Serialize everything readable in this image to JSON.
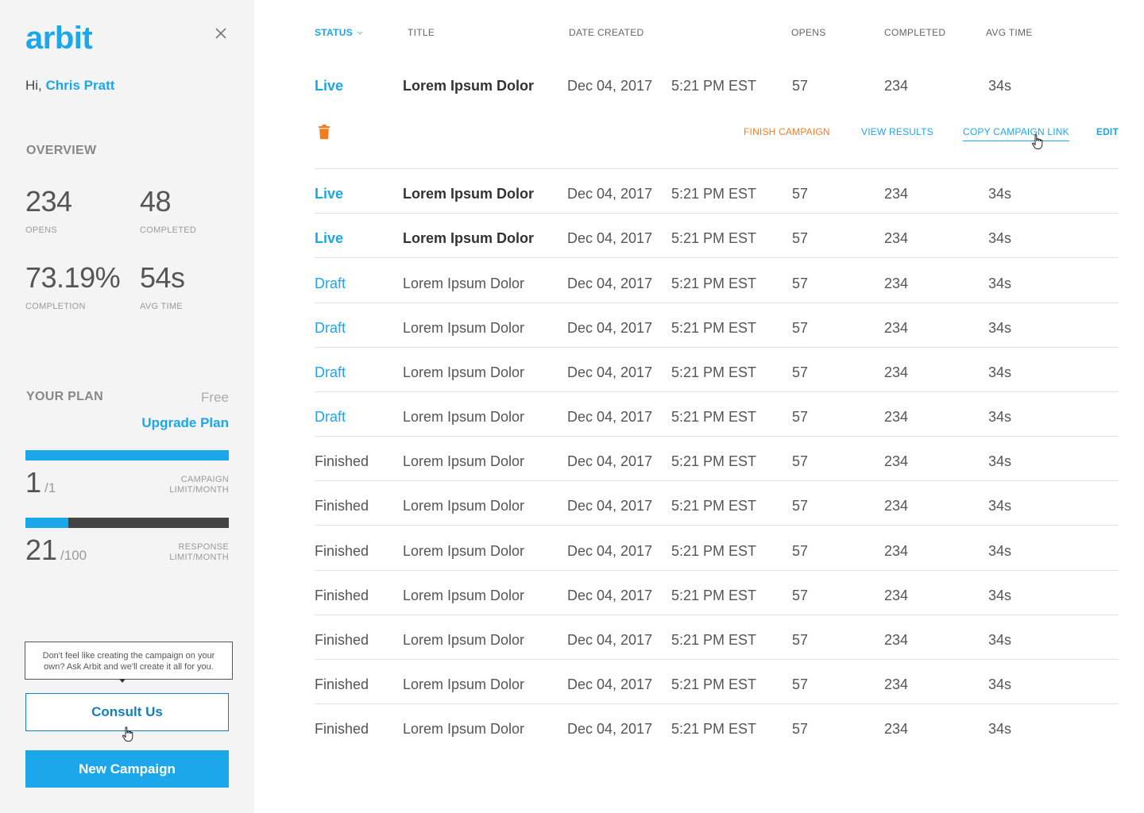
{
  "sidebar": {
    "logo": "arbit",
    "greeting_prefix": "Hi, ",
    "user_name": "Chris Pratt",
    "overview_title": "OVERVIEW",
    "stats": [
      {
        "value": "234",
        "label": "OPENS"
      },
      {
        "value": "48",
        "label": "COMPLETED"
      },
      {
        "value": "73.19%",
        "label": "COMPLETION"
      },
      {
        "value": "54s",
        "label": "AVG TIME"
      }
    ],
    "plan": {
      "title": "YOUR PLAN",
      "name": "Free",
      "upgrade_label": "Upgrade Plan",
      "campaign_usage": {
        "value": "1",
        "max": "/1",
        "label": "CAMPAIGN LIMIT/MONTH",
        "fill_fraction": 1.0
      },
      "response_usage": {
        "value": "21",
        "max": "/100",
        "label": "RESPONSE LIMIT/MONTH",
        "fill_fraction": 0.21
      }
    },
    "tooltip": "Don't feel like creating the campaign on your own? Ask Arbit and we'll create it all for you.",
    "consult_label": "Consult Us",
    "new_campaign_label": "New Campaign"
  },
  "table": {
    "headers": {
      "status": "STATUS",
      "title": "TITLE",
      "date_created": "DATE CREATED",
      "opens": "OPENS",
      "completed": "COMPLETED",
      "avg_time": "AVG TIME"
    },
    "actions": {
      "finish": "FINISH CAMPAIGN",
      "view": "VIEW RESULTS",
      "copy": "COPY CAMPAIGN LINK",
      "edit": "EDIT"
    },
    "rows": [
      {
        "status": "Live",
        "title": "Lorem Ipsum Dolor",
        "date": "Dec 04, 2017",
        "time": "5:21 PM EST",
        "opens": "57",
        "completed": "234",
        "avg_time": "34s"
      },
      {
        "status": "Live",
        "title": "Lorem Ipsum Dolor",
        "date": "Dec 04, 2017",
        "time": "5:21 PM EST",
        "opens": "57",
        "completed": "234",
        "avg_time": "34s"
      },
      {
        "status": "Live",
        "title": "Lorem Ipsum Dolor",
        "date": "Dec 04, 2017",
        "time": "5:21 PM EST",
        "opens": "57",
        "completed": "234",
        "avg_time": "34s"
      },
      {
        "status": "Draft",
        "title": "Lorem Ipsum Dolor",
        "date": "Dec 04, 2017",
        "time": "5:21 PM EST",
        "opens": "57",
        "completed": "234",
        "avg_time": "34s"
      },
      {
        "status": "Draft",
        "title": "Lorem Ipsum Dolor",
        "date": "Dec 04, 2017",
        "time": "5:21 PM EST",
        "opens": "57",
        "completed": "234",
        "avg_time": "34s"
      },
      {
        "status": "Draft",
        "title": "Lorem Ipsum Dolor",
        "date": "Dec 04, 2017",
        "time": "5:21 PM EST",
        "opens": "57",
        "completed": "234",
        "avg_time": "34s"
      },
      {
        "status": "Draft",
        "title": "Lorem Ipsum Dolor",
        "date": "Dec 04, 2017",
        "time": "5:21 PM EST",
        "opens": "57",
        "completed": "234",
        "avg_time": "34s"
      },
      {
        "status": "Finished",
        "title": "Lorem Ipsum Dolor",
        "date": "Dec 04, 2017",
        "time": "5:21 PM EST",
        "opens": "57",
        "completed": "234",
        "avg_time": "34s"
      },
      {
        "status": "Finished",
        "title": "Lorem Ipsum Dolor",
        "date": "Dec 04, 2017",
        "time": "5:21 PM EST",
        "opens": "57",
        "completed": "234",
        "avg_time": "34s"
      },
      {
        "status": "Finished",
        "title": "Lorem Ipsum Dolor",
        "date": "Dec 04, 2017",
        "time": "5:21 PM EST",
        "opens": "57",
        "completed": "234",
        "avg_time": "34s"
      },
      {
        "status": "Finished",
        "title": "Lorem Ipsum Dolor",
        "date": "Dec 04, 2017",
        "time": "5:21 PM EST",
        "opens": "57",
        "completed": "234",
        "avg_time": "34s"
      },
      {
        "status": "Finished",
        "title": "Lorem Ipsum Dolor",
        "date": "Dec 04, 2017",
        "time": "5:21 PM EST",
        "opens": "57",
        "completed": "234",
        "avg_time": "34s"
      },
      {
        "status": "Finished",
        "title": "Lorem Ipsum Dolor",
        "date": "Dec 04, 2017",
        "time": "5:21 PM EST",
        "opens": "57",
        "completed": "234",
        "avg_time": "34s"
      },
      {
        "status": "Finished",
        "title": "Lorem Ipsum Dolor",
        "date": "Dec 04, 2017",
        "time": "5:21 PM EST",
        "opens": "57",
        "completed": "234",
        "avg_time": "34s"
      }
    ]
  },
  "colors": {
    "accent": "#1ca7ea",
    "warning": "#f47c20",
    "sidebar_bg": "#f4f4f4"
  }
}
